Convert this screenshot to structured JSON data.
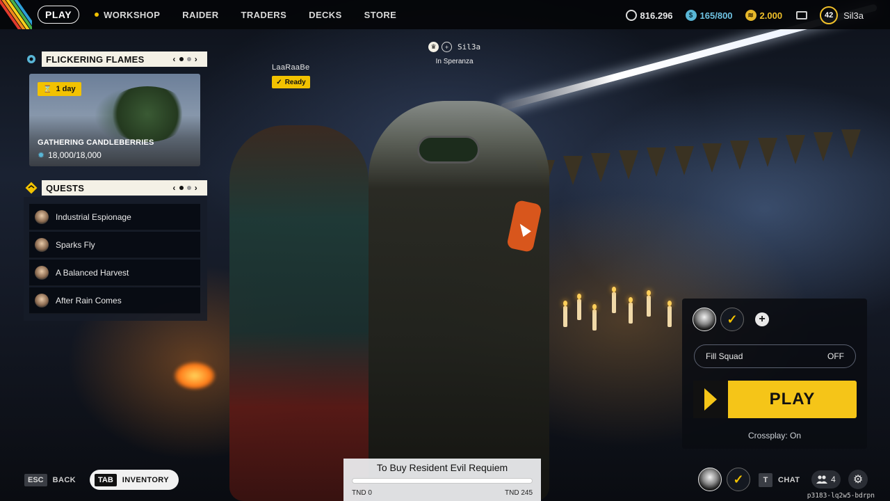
{
  "topbar": {
    "play_label": "PLAY",
    "nav": [
      "WORKSHOP",
      "RAIDER",
      "TRADERS",
      "DECKS",
      "STORE"
    ],
    "currency_silver": "816.296",
    "currency_blue": "165/800",
    "currency_gold": "2.000",
    "level": "42",
    "username": "Sil3a"
  },
  "event": {
    "title": "FLICKERING FLAMES",
    "pager_left": "‹",
    "pager_right": "›",
    "time_badge": "1 day",
    "card_title": "GATHERING CANDLEBERRIES",
    "progress": "18,000/18,000"
  },
  "quests": {
    "title": "QUESTS",
    "items": [
      "Industrial Espionage",
      "Sparks Fly",
      "A Balanced Harvest",
      "After Rain Comes"
    ]
  },
  "squad": {
    "member_left": "LaaRaaBe",
    "ready_label": "Ready",
    "member_mid": "Sil3a",
    "location": "In Speranza"
  },
  "play_panel": {
    "fill_squad_label": "Fill Squad",
    "fill_squad_value": "OFF",
    "play_label": "PLAY",
    "crossplay": "Crossplay: On"
  },
  "bottom": {
    "esc_key": "ESC",
    "back_label": "BACK",
    "tab_key": "TAB",
    "inventory_label": "INVENTORY",
    "chat_key": "T",
    "chat_label": "CHAT",
    "friends_count": "4",
    "session_id": "p3183-lq2w5-bdrpn"
  },
  "purchase": {
    "title": "To Buy Resident Evil Requiem",
    "min_label": "TND 0",
    "max_label": "TND 245",
    "progress_fraction": 0.0
  },
  "colors": {
    "accent_yellow": "#f2c200",
    "accent_blue": "#59b6d6"
  }
}
